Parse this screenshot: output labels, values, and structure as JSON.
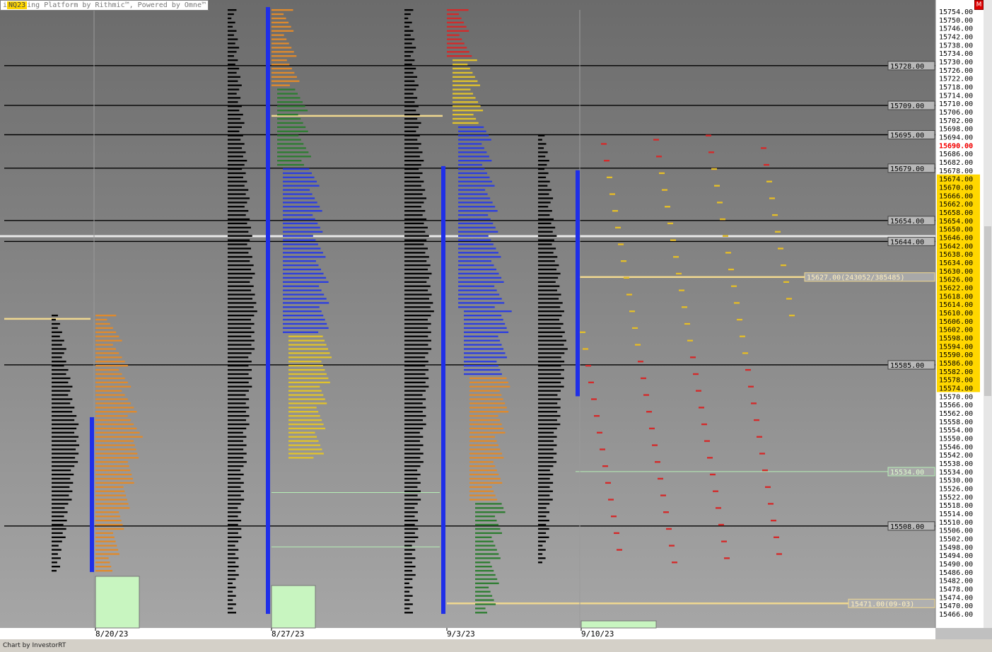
{
  "app": {
    "title_symbol": "NQ23",
    "title_text": "ing Platform by Rithmic™, Powered by Omne™",
    "close_label": "M",
    "status_text": "Chart by InvestorRT"
  },
  "chart_data": {
    "type": "market-profile",
    "price_axis": {
      "min": 15464,
      "max": 15756,
      "step": 4,
      "position": "right"
    },
    "date_labels": [
      "8/20/23",
      "8/27/23",
      "9/3/23",
      "9/10/23"
    ],
    "current_price": 15690.0,
    "last_price_color": "#ff0000",
    "highlight_range": [
      15572,
      15676
    ],
    "highlight_color": "#ffd700",
    "horizontal_levels": [
      15728.0,
      15709.0,
      15695.0,
      15679.0,
      15654.0,
      15644.0,
      15585.0,
      15508.0
    ],
    "level_labels": [
      "15728.00",
      "15709.00",
      "15695.00",
      "15679.00",
      "15654.00",
      "15644.00",
      "15585.00",
      "15508.00"
    ],
    "vpoc_label": "15627.00(243052/385485)",
    "vpoc_price": 15627.0,
    "green_level_label": "15534.00",
    "green_level": 15534.0,
    "naked_poc_label": "15471.00(09-03)",
    "naked_poc": 15471.0,
    "poc_lines": [
      {
        "profile": "8/20/23",
        "price": 15607
      },
      {
        "profile": "8/27/23",
        "price": 15704
      },
      {
        "profile": "9/3/23",
        "price": 15471
      },
      {
        "profile": "9/10/23",
        "price": 15627
      }
    ],
    "profiles": [
      {
        "date": "8/20/23",
        "high": 15610,
        "low": 15486,
        "segments": [
          {
            "from": 15486,
            "to": 15610,
            "color": "#e08a2c"
          }
        ],
        "value_area": [
          15540,
          15590
        ],
        "initial_balance": [
          15486,
          15560
        ]
      },
      {
        "date": "8/27/23",
        "high": 15756,
        "low": 15466,
        "segments": [
          {
            "from": 15718,
            "to": 15756,
            "color": "#e08a2c"
          },
          {
            "from": 15680,
            "to": 15718,
            "color": "#2e7d32"
          },
          {
            "from": 15600,
            "to": 15680,
            "color": "#2c3ee0"
          },
          {
            "from": 15540,
            "to": 15600,
            "color": "#e0c22c"
          }
        ],
        "value_area": [
          15612,
          15720
        ],
        "initial_balance": [
          15466,
          15756
        ]
      },
      {
        "date": "9/3/23",
        "high": 15756,
        "low": 15466,
        "segments": [
          {
            "from": 15732,
            "to": 15756,
            "color": "#d42a2a"
          },
          {
            "from": 15700,
            "to": 15732,
            "color": "#e0c22c"
          },
          {
            "from": 15612,
            "to": 15700,
            "color": "#2c3ee0"
          },
          {
            "from": 15580,
            "to": 15612,
            "color": "#2c3ee0"
          },
          {
            "from": 15520,
            "to": 15580,
            "color": "#e08a2c"
          },
          {
            "from": 15466,
            "to": 15520,
            "color": "#2e7d32"
          }
        ],
        "value_area": [
          15466,
          15600
        ],
        "initial_balance": [
          15466,
          15680
        ]
      },
      {
        "date": "9/10/23",
        "high": 15695,
        "low": 15490,
        "segments": [
          {
            "from": 15490,
            "to": 15695,
            "color": "#d42a2a"
          },
          {
            "from": 15590,
            "to": 15680,
            "color": "#e0c22c"
          }
        ],
        "value_area": [
          15574,
          15676
        ],
        "initial_balance": [
          15570,
          15678
        ]
      }
    ],
    "grid": false,
    "legend": "none"
  }
}
